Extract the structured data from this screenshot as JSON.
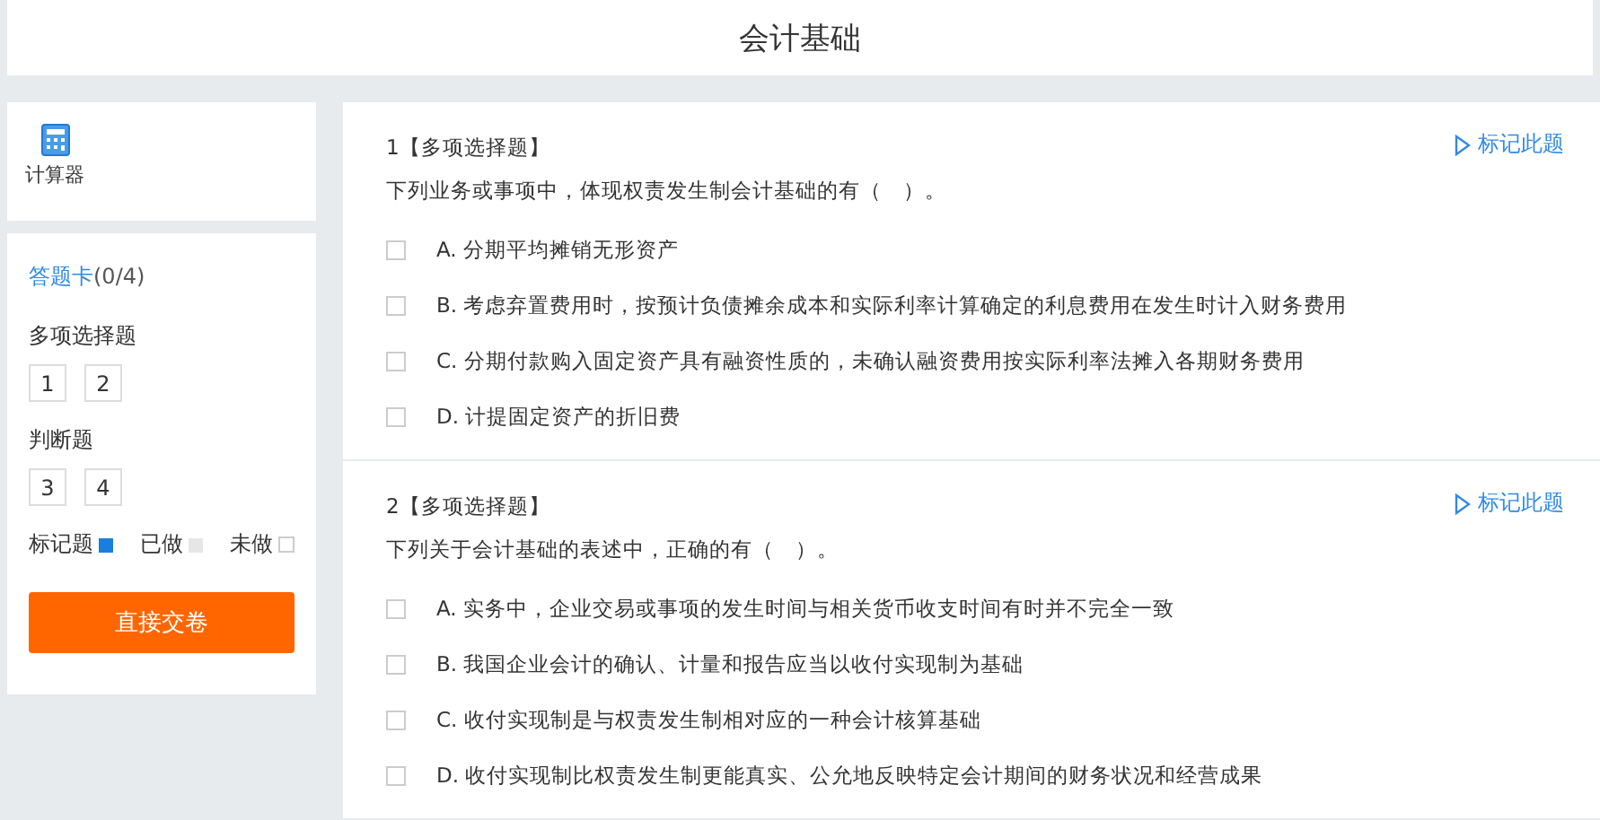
{
  "header": {
    "title": "会计基础"
  },
  "tools": [
    {
      "label": "计算器"
    }
  ],
  "answer_card": {
    "title": "答题卡",
    "count": "(0/4)",
    "sections": [
      {
        "title": "多项选择题",
        "numbers": [
          "1",
          "2"
        ]
      },
      {
        "title": "判断题",
        "numbers": [
          "3",
          "4"
        ]
      }
    ],
    "legend": [
      {
        "label": "标记题",
        "kind": "marked"
      },
      {
        "label": "已做",
        "kind": "done"
      },
      {
        "label": "未做",
        "kind": "todo"
      }
    ],
    "submit": "直接交卷"
  },
  "questions": [
    {
      "number": "1",
      "type": "【多项选择题】",
      "mark": "标记此题",
      "stem": "下列业务或事项中，体现权责发生制会计基础的有（　）。",
      "options": [
        {
          "text": "A. 分期平均摊销无形资产",
          "checked": false
        },
        {
          "text": "B. 考虑弃置费用时，按预计负债摊余成本和实际利率计算确定的利息费用在发生时计入财务费用",
          "checked": false
        },
        {
          "text": "C. 分期付款购入固定资产具有融资性质的，未确认融资费用按实际利率法摊入各期财务费用",
          "checked": false
        },
        {
          "text": "D. 计提固定资产的折旧费",
          "checked": false
        }
      ]
    },
    {
      "number": "2",
      "type": "【多项选择题】",
      "mark": "标记此题",
      "stem": "下列关于会计基础的表述中，正确的有（　）。",
      "options": [
        {
          "text": "A. 实务中，企业交易或事项的发生时间与相关货币收支时间有时并不完全一致",
          "checked": false
        },
        {
          "text": "B. 我国企业会计的确认、计量和报告应当以收付实现制为基础",
          "checked": false
        },
        {
          "text": "C. 收付实现制是与权责发生制相对应的一种会计核算基础",
          "checked": false
        },
        {
          "text": "D. 收付实现制比权责发生制更能真实、公允地反映特定会计期间的财务状况和经营成果",
          "checked": false
        }
      ]
    }
  ]
}
